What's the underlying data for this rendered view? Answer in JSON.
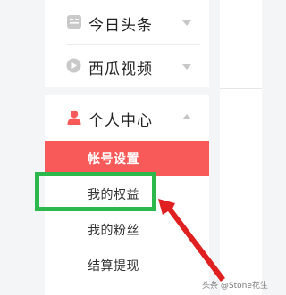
{
  "nav": {
    "toutiao": {
      "label": "今日头条",
      "icon": "toutiao-icon"
    },
    "xigua": {
      "label": "西瓜视频",
      "icon": "xigua-video-icon"
    },
    "personal_center": {
      "label": "个人中心",
      "icon": "user-icon",
      "accent_color": "#f85959"
    }
  },
  "submenu": [
    {
      "label": "帐号设置",
      "active": true
    },
    {
      "label": "我的权益",
      "active": false
    },
    {
      "label": "我的粉丝",
      "active": false
    },
    {
      "label": "结算提现",
      "active": false
    }
  ],
  "annotation": {
    "highlight_color": "#2db84d",
    "arrow_color": "#e02020"
  },
  "watermark": "头条 @Stone花生"
}
